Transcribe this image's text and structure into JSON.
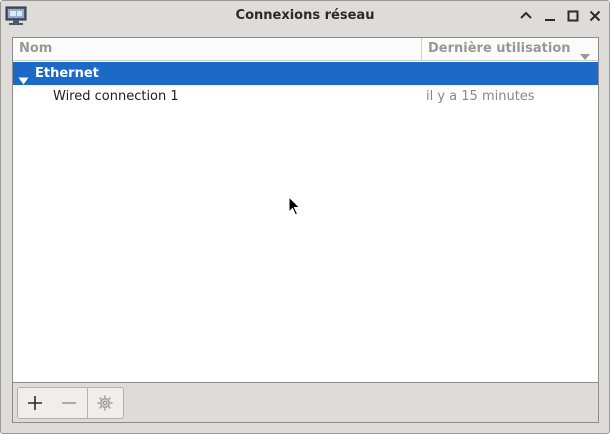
{
  "window": {
    "title": "Connexions réseau"
  },
  "list": {
    "columns": {
      "name": "Nom",
      "last_used": "Dernière utilisation"
    },
    "groups": [
      {
        "label": "Ethernet",
        "expanded": true,
        "selected": true,
        "connections": [
          {
            "name": "Wired connection 1",
            "last_used": "il y a 15 minutes"
          }
        ]
      }
    ]
  },
  "toolbar": {
    "add_icon": "plus-icon",
    "remove_icon": "minus-icon",
    "settings_icon": "gear-icon"
  },
  "colors": {
    "selection": "#1d69c8",
    "window_bg": "#dedcd9"
  }
}
